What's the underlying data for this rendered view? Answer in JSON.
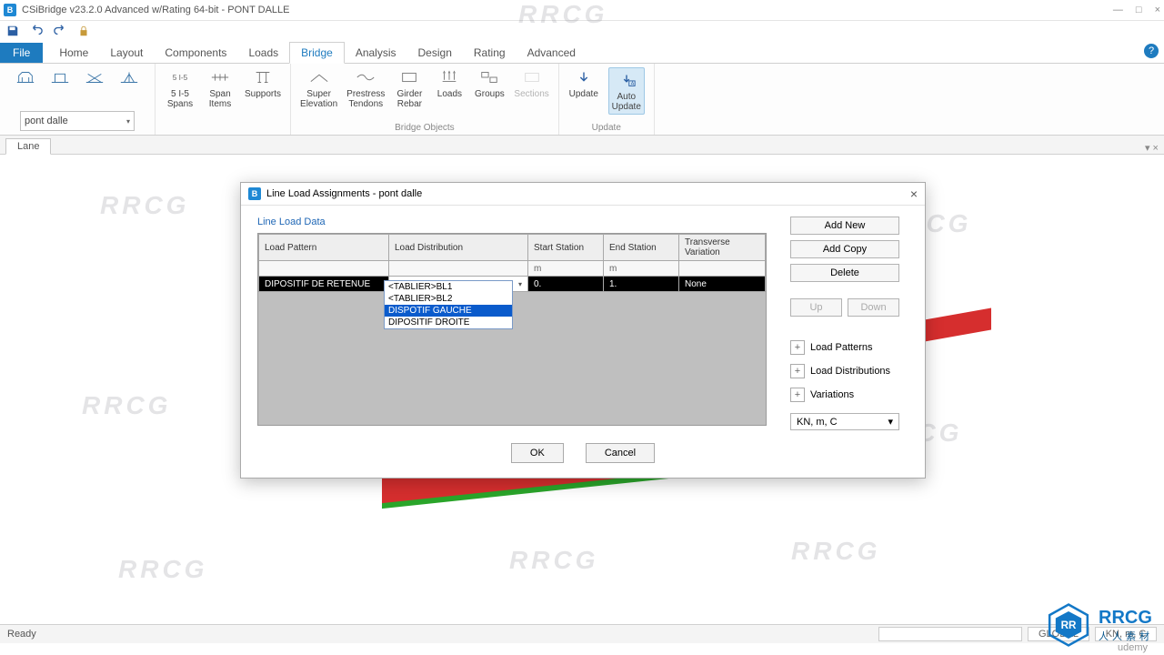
{
  "window": {
    "title": "CSiBridge v23.2.0 Advanced w/Rating 64-bit - PONT DALLE",
    "min": "—",
    "max": "□",
    "close": "×"
  },
  "qat": {
    "save_tip": "Save",
    "undo_tip": "Undo",
    "redo_tip": "Redo",
    "lock_tip": "Lock"
  },
  "menu": {
    "file": "File",
    "tabs": [
      "Home",
      "Layout",
      "Components",
      "Loads",
      "Bridge",
      "Analysis",
      "Design",
      "Rating",
      "Advanced"
    ],
    "active": 4,
    "help": "?"
  },
  "ribbon": {
    "combo_value": "pont dalle",
    "groups": [
      {
        "label": "",
        "buttons": []
      },
      {
        "label": "",
        "buttons": [
          {
            "text": "5 I-5\nSpans",
            "name": "spans-button"
          },
          {
            "text": "Span\nItems",
            "name": "span-items-button"
          },
          {
            "text": "Supports",
            "name": "supports-button"
          }
        ]
      },
      {
        "label": "Bridge Objects",
        "buttons": [
          {
            "text": "Super\nElevation",
            "name": "super-elevation-button"
          },
          {
            "text": "Prestress\nTendons",
            "name": "prestress-tendons-button"
          },
          {
            "text": "Girder\nRebar",
            "name": "girder-rebar-button"
          },
          {
            "text": "Loads",
            "name": "loads-button"
          },
          {
            "text": "Groups",
            "name": "groups-button"
          },
          {
            "text": "Sections",
            "name": "sections-button"
          }
        ]
      },
      {
        "label": "Update",
        "buttons": [
          {
            "text": "Update",
            "name": "update-button"
          },
          {
            "text": "Auto\nUpdate",
            "name": "auto-update-button",
            "active": true
          }
        ]
      }
    ]
  },
  "doctab": {
    "label": "Lane",
    "right_controls": "▾ ×"
  },
  "dialog": {
    "title": "Line Load Assignments - pont dalle",
    "section_label": "Line Load Data",
    "columns": [
      "Load Pattern",
      "Load Distribution",
      "Start Station",
      "End Station",
      "Transverse Variation"
    ],
    "units_row": [
      "",
      "",
      "m",
      "m",
      ""
    ],
    "row": {
      "pattern": "DIPOSITIF DE RETENUE",
      "distribution": "<TABLIER>BL1",
      "start": "0.",
      "end": "1.",
      "variation": "None"
    },
    "dropdown_options": [
      "<TABLIER>BL1",
      "<TABLIER>BL2",
      "DISPOTIF GAUCHE",
      "DIPOSITIF DROITE"
    ],
    "dropdown_hi": 2,
    "buttons": {
      "add_new": "Add New",
      "add_copy": "Add Copy",
      "delete": "Delete",
      "up": "Up",
      "down": "Down"
    },
    "expanders": [
      "Load Patterns",
      "Load Distributions",
      "Variations"
    ],
    "units_combo": "KN, m, C",
    "ok": "OK",
    "cancel": "Cancel",
    "close": "×"
  },
  "status": {
    "left": "Ready",
    "global": "GLOBAL",
    "units": "KN, m, C"
  },
  "watermark_text": "RRCG",
  "branding": {
    "logo": "RRCG",
    "sub": "人人素材",
    "udemy": "udemy"
  }
}
